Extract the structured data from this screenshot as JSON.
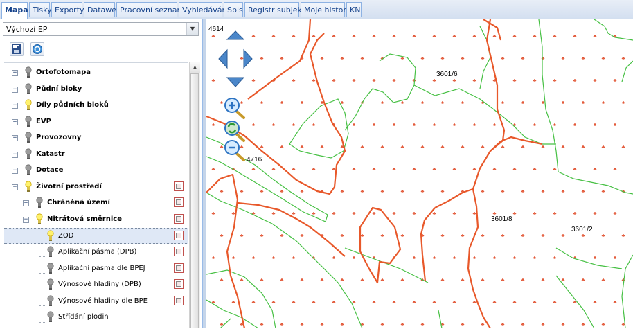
{
  "tabs": [
    {
      "label": "Mapa",
      "active": true
    },
    {
      "label": "Tisky"
    },
    {
      "label": "Exporty"
    },
    {
      "label": "Datawell"
    },
    {
      "label": "Pracovní seznamy"
    },
    {
      "label": "Vyhledávání"
    },
    {
      "label": "Spis"
    },
    {
      "label": "Registr subjektů"
    },
    {
      "label": "Moje historie"
    },
    {
      "label": "KN"
    }
  ],
  "profile_select": {
    "value": "Výchozí EP"
  },
  "toolbar": {
    "save_icon": "floppy-disk-icon",
    "refresh_icon": "refresh-icon"
  },
  "tree": {
    "items": [
      {
        "label": "Ortofotomapa",
        "bold": true,
        "bulb": "off"
      },
      {
        "label": "Půdní bloky",
        "bold": true,
        "bulb": "off"
      },
      {
        "label": "Díly půdních bloků",
        "bold": true,
        "bulb": "on"
      },
      {
        "label": "EVP",
        "bold": true,
        "bulb": "off"
      },
      {
        "label": "Provozovny",
        "bold": true,
        "bulb": "off"
      },
      {
        "label": "Katastr",
        "bold": true,
        "bulb": "off"
      },
      {
        "label": "Dotace",
        "bold": true,
        "bulb": "off"
      },
      {
        "label": "Životní prostředí",
        "bold": true,
        "bulb": "on"
      },
      {
        "label": "Chráněná území",
        "bold": true,
        "bulb": "off"
      },
      {
        "label": "Nitrátová směrnice",
        "bold": true,
        "bulb": "on"
      },
      {
        "label": "ZOD",
        "bold": false,
        "bulb": "on",
        "selected": true
      },
      {
        "label": "Aplikační pásma (DPB)",
        "bold": false,
        "bulb": "off"
      },
      {
        "label": "Aplikační pásma dle BPEJ",
        "bold": false,
        "bulb": "off"
      },
      {
        "label": "Výnosové hladiny (DPB)",
        "bold": false,
        "bulb": "off"
      },
      {
        "label": "Výnosové hladiny dle BPE",
        "bold": false,
        "bulb": "off"
      },
      {
        "label": "Střídání plodin",
        "bold": false,
        "bulb": "off"
      }
    ]
  },
  "map": {
    "labels": {
      "l4614": "4614",
      "l4716": "4716",
      "l3601_6": "3601/6",
      "l3601_8": "3601/8",
      "l3601_2": "3601/2"
    },
    "controls": [
      "pan-up-icon",
      "pan-left-icon",
      "pan-right-icon",
      "pan-down-icon",
      "zoom-in-icon",
      "zoom-reset-icon",
      "zoom-out-icon"
    ],
    "colors": {
      "parcel_border": "#e8582a",
      "vegetation_line": "#46c043",
      "marker": "#e35a3a"
    }
  }
}
